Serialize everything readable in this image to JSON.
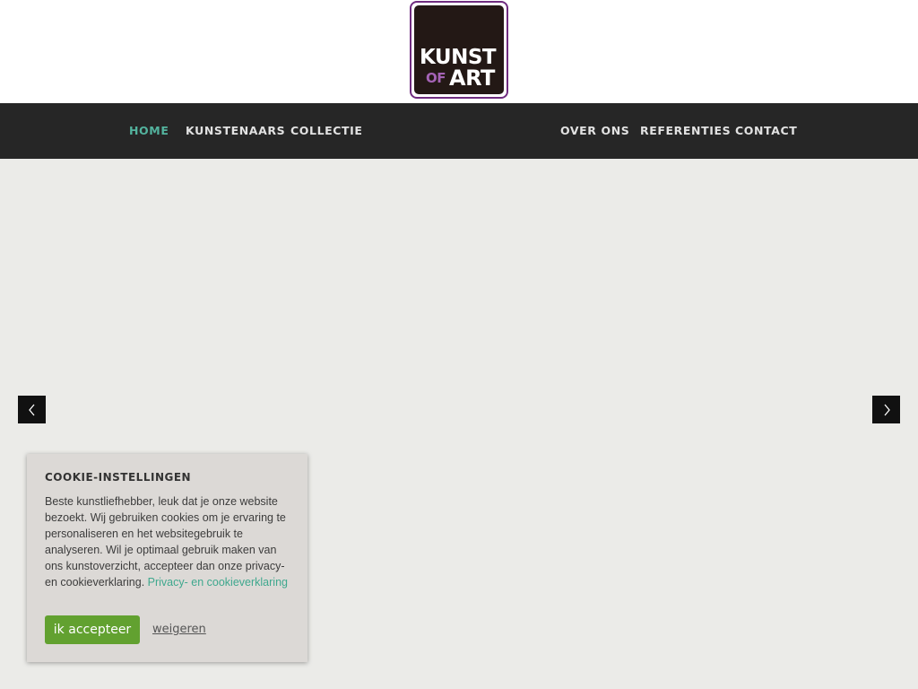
{
  "logo": {
    "line1": "KUNST",
    "of": "OF",
    "art": "ART",
    "border_color": "#6f2c7f",
    "of_color": "#a463b5"
  },
  "nav": {
    "items": [
      {
        "label": "HOME",
        "active": true
      },
      {
        "label": "KUNSTENAARS",
        "active": false
      },
      {
        "label": "COLLECTIE",
        "active": false
      },
      {
        "label": "OVER ONS",
        "active": false
      },
      {
        "label": "REFERENTIES",
        "active": false
      },
      {
        "label": "CONTACT",
        "active": false
      }
    ],
    "active_color": "#53b39e"
  },
  "slider": {
    "prev_icon": "chevron-left-icon",
    "next_icon": "chevron-right-icon"
  },
  "cookie": {
    "title": "COOKIE-INSTELLINGEN",
    "text": "Beste kunstliefhebber, leuk dat je onze website bezoekt. Wij gebruiken cookies om je ervaring te personaliseren en het websitegebruik te analyseren. Wil je optimaal gebruik maken van ons kunstoverzicht, accepteer dan onze privacy- en cookieverklaring. ",
    "link": "Privacy- en cookieverklaring",
    "accept": "ik accepteer",
    "decline": "weigeren",
    "accept_color": "#62a130",
    "link_color": "#3fa88e"
  }
}
